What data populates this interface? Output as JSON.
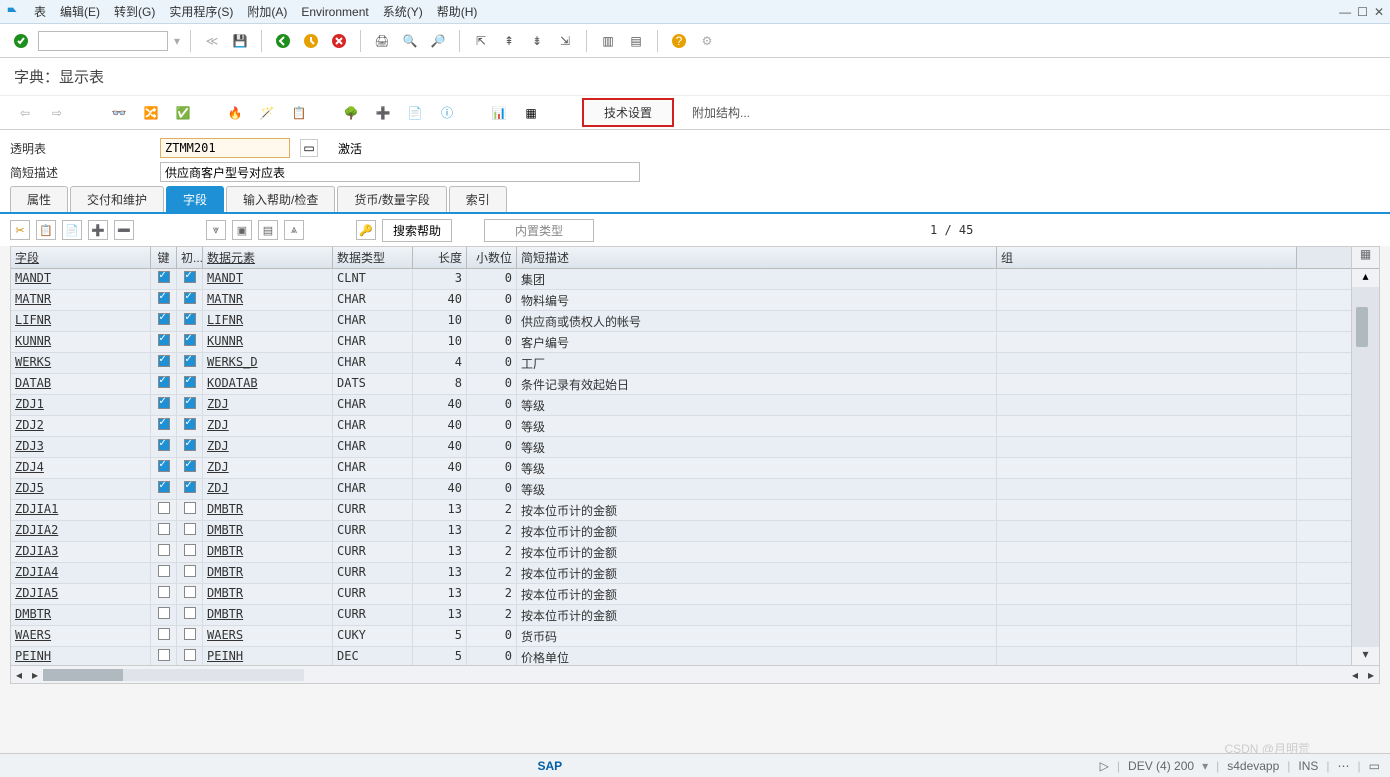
{
  "menubar": {
    "items": [
      "表",
      "编辑(E)",
      "转到(G)",
      "实用程序(S)",
      "附加(A)",
      "Environment",
      "系统(Y)",
      "帮助(H)"
    ]
  },
  "page_title": "字典：显示表",
  "tb2": {
    "tech_settings": "技术设置",
    "append_struct": "附加结构..."
  },
  "form": {
    "transp_label": "透明表",
    "transp_value": "ZTMM201",
    "status": "激活",
    "desc_label": "简短描述",
    "desc_value": "供应商客户型号对应表"
  },
  "tabs": [
    "属性",
    "交付和维护",
    "字段",
    "输入帮助/检查",
    "货币/数量字段",
    "索引"
  ],
  "active_tab": 2,
  "subtool": {
    "search_help": "搜索帮助",
    "builtin_type": "内置类型",
    "counter": "1 / 45"
  },
  "grid": {
    "headers": [
      "字段",
      "键",
      "初...",
      "数据元素",
      "数据类型",
      "长度",
      "小数位",
      "简短描述",
      "组"
    ],
    "rows": [
      {
        "f": "MANDT",
        "k": true,
        "i": true,
        "e": "MANDT",
        "t": "CLNT",
        "l": "3",
        "d": "0",
        "s": "集团"
      },
      {
        "f": "MATNR",
        "k": true,
        "i": true,
        "e": "MATNR",
        "t": "CHAR",
        "l": "40",
        "d": "0",
        "s": "物料编号"
      },
      {
        "f": "LIFNR",
        "k": true,
        "i": true,
        "e": "LIFNR",
        "t": "CHAR",
        "l": "10",
        "d": "0",
        "s": "供应商或债权人的帐号"
      },
      {
        "f": "KUNNR",
        "k": true,
        "i": true,
        "e": "KUNNR",
        "t": "CHAR",
        "l": "10",
        "d": "0",
        "s": "客户编号"
      },
      {
        "f": "WERKS",
        "k": true,
        "i": true,
        "e": "WERKS_D",
        "t": "CHAR",
        "l": "4",
        "d": "0",
        "s": "工厂"
      },
      {
        "f": "DATAB",
        "k": true,
        "i": true,
        "e": "KODATAB",
        "t": "DATS",
        "l": "8",
        "d": "0",
        "s": "条件记录有效起始日"
      },
      {
        "f": "ZDJ1",
        "k": true,
        "i": true,
        "e": "ZDJ",
        "t": "CHAR",
        "l": "40",
        "d": "0",
        "s": "等级"
      },
      {
        "f": "ZDJ2",
        "k": true,
        "i": true,
        "e": "ZDJ",
        "t": "CHAR",
        "l": "40",
        "d": "0",
        "s": "等级"
      },
      {
        "f": "ZDJ3",
        "k": true,
        "i": true,
        "e": "ZDJ",
        "t": "CHAR",
        "l": "40",
        "d": "0",
        "s": "等级"
      },
      {
        "f": "ZDJ4",
        "k": true,
        "i": true,
        "e": "ZDJ",
        "t": "CHAR",
        "l": "40",
        "d": "0",
        "s": "等级"
      },
      {
        "f": "ZDJ5",
        "k": true,
        "i": true,
        "e": "ZDJ",
        "t": "CHAR",
        "l": "40",
        "d": "0",
        "s": "等级"
      },
      {
        "f": "ZDJIA1",
        "k": false,
        "i": false,
        "e": "DMBTR",
        "t": "CURR",
        "l": "13",
        "d": "2",
        "s": "按本位币计的金额"
      },
      {
        "f": "ZDJIA2",
        "k": false,
        "i": false,
        "e": "DMBTR",
        "t": "CURR",
        "l": "13",
        "d": "2",
        "s": "按本位币计的金额"
      },
      {
        "f": "ZDJIA3",
        "k": false,
        "i": false,
        "e": "DMBTR",
        "t": "CURR",
        "l": "13",
        "d": "2",
        "s": "按本位币计的金额"
      },
      {
        "f": "ZDJIA4",
        "k": false,
        "i": false,
        "e": "DMBTR",
        "t": "CURR",
        "l": "13",
        "d": "2",
        "s": "按本位币计的金额"
      },
      {
        "f": "ZDJIA5",
        "k": false,
        "i": false,
        "e": "DMBTR",
        "t": "CURR",
        "l": "13",
        "d": "2",
        "s": "按本位币计的金额"
      },
      {
        "f": "DMBTR",
        "k": false,
        "i": false,
        "e": "DMBTR",
        "t": "CURR",
        "l": "13",
        "d": "2",
        "s": "按本位币计的金额"
      },
      {
        "f": "WAERS",
        "k": false,
        "i": false,
        "e": "WAERS",
        "t": "CUKY",
        "l": "5",
        "d": "0",
        "s": "货币码"
      },
      {
        "f": "PEINH",
        "k": false,
        "i": false,
        "e": "PEINH",
        "t": "DEC",
        "l": "5",
        "d": "0",
        "s": "价格单位"
      }
    ]
  },
  "status": {
    "sap": "SAP",
    "system": "DEV (4) 200",
    "host": "s4devapp",
    "mode": "INS"
  },
  "watermark": "CSDN @月明荒"
}
